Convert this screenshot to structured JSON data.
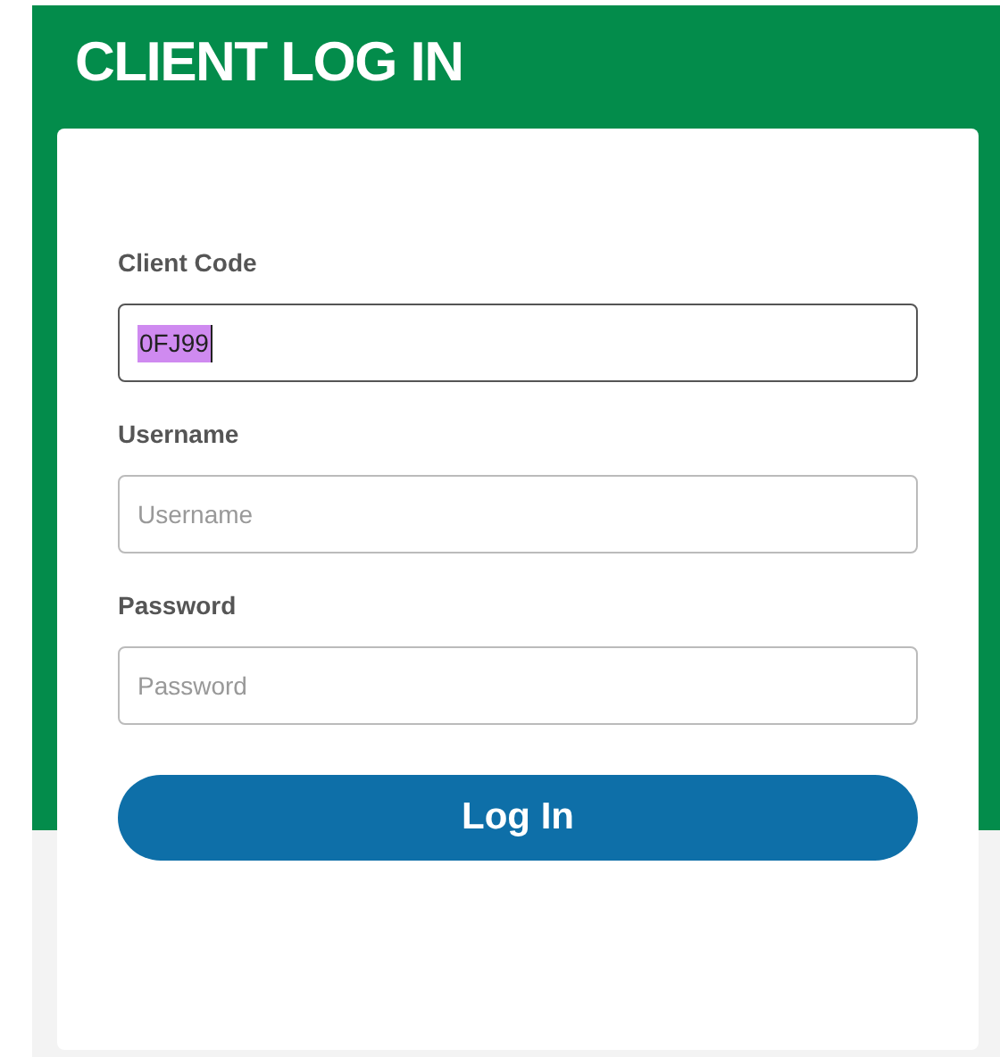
{
  "title": "CLIENT LOG IN",
  "fields": [
    {
      "label": "Client Code",
      "value": "0FJ99",
      "focused": true
    },
    {
      "label": "Username",
      "placeholder": "Username",
      "focused": false
    },
    {
      "label": "Password",
      "placeholder": "Password",
      "focused": false
    }
  ],
  "button": "Log In"
}
